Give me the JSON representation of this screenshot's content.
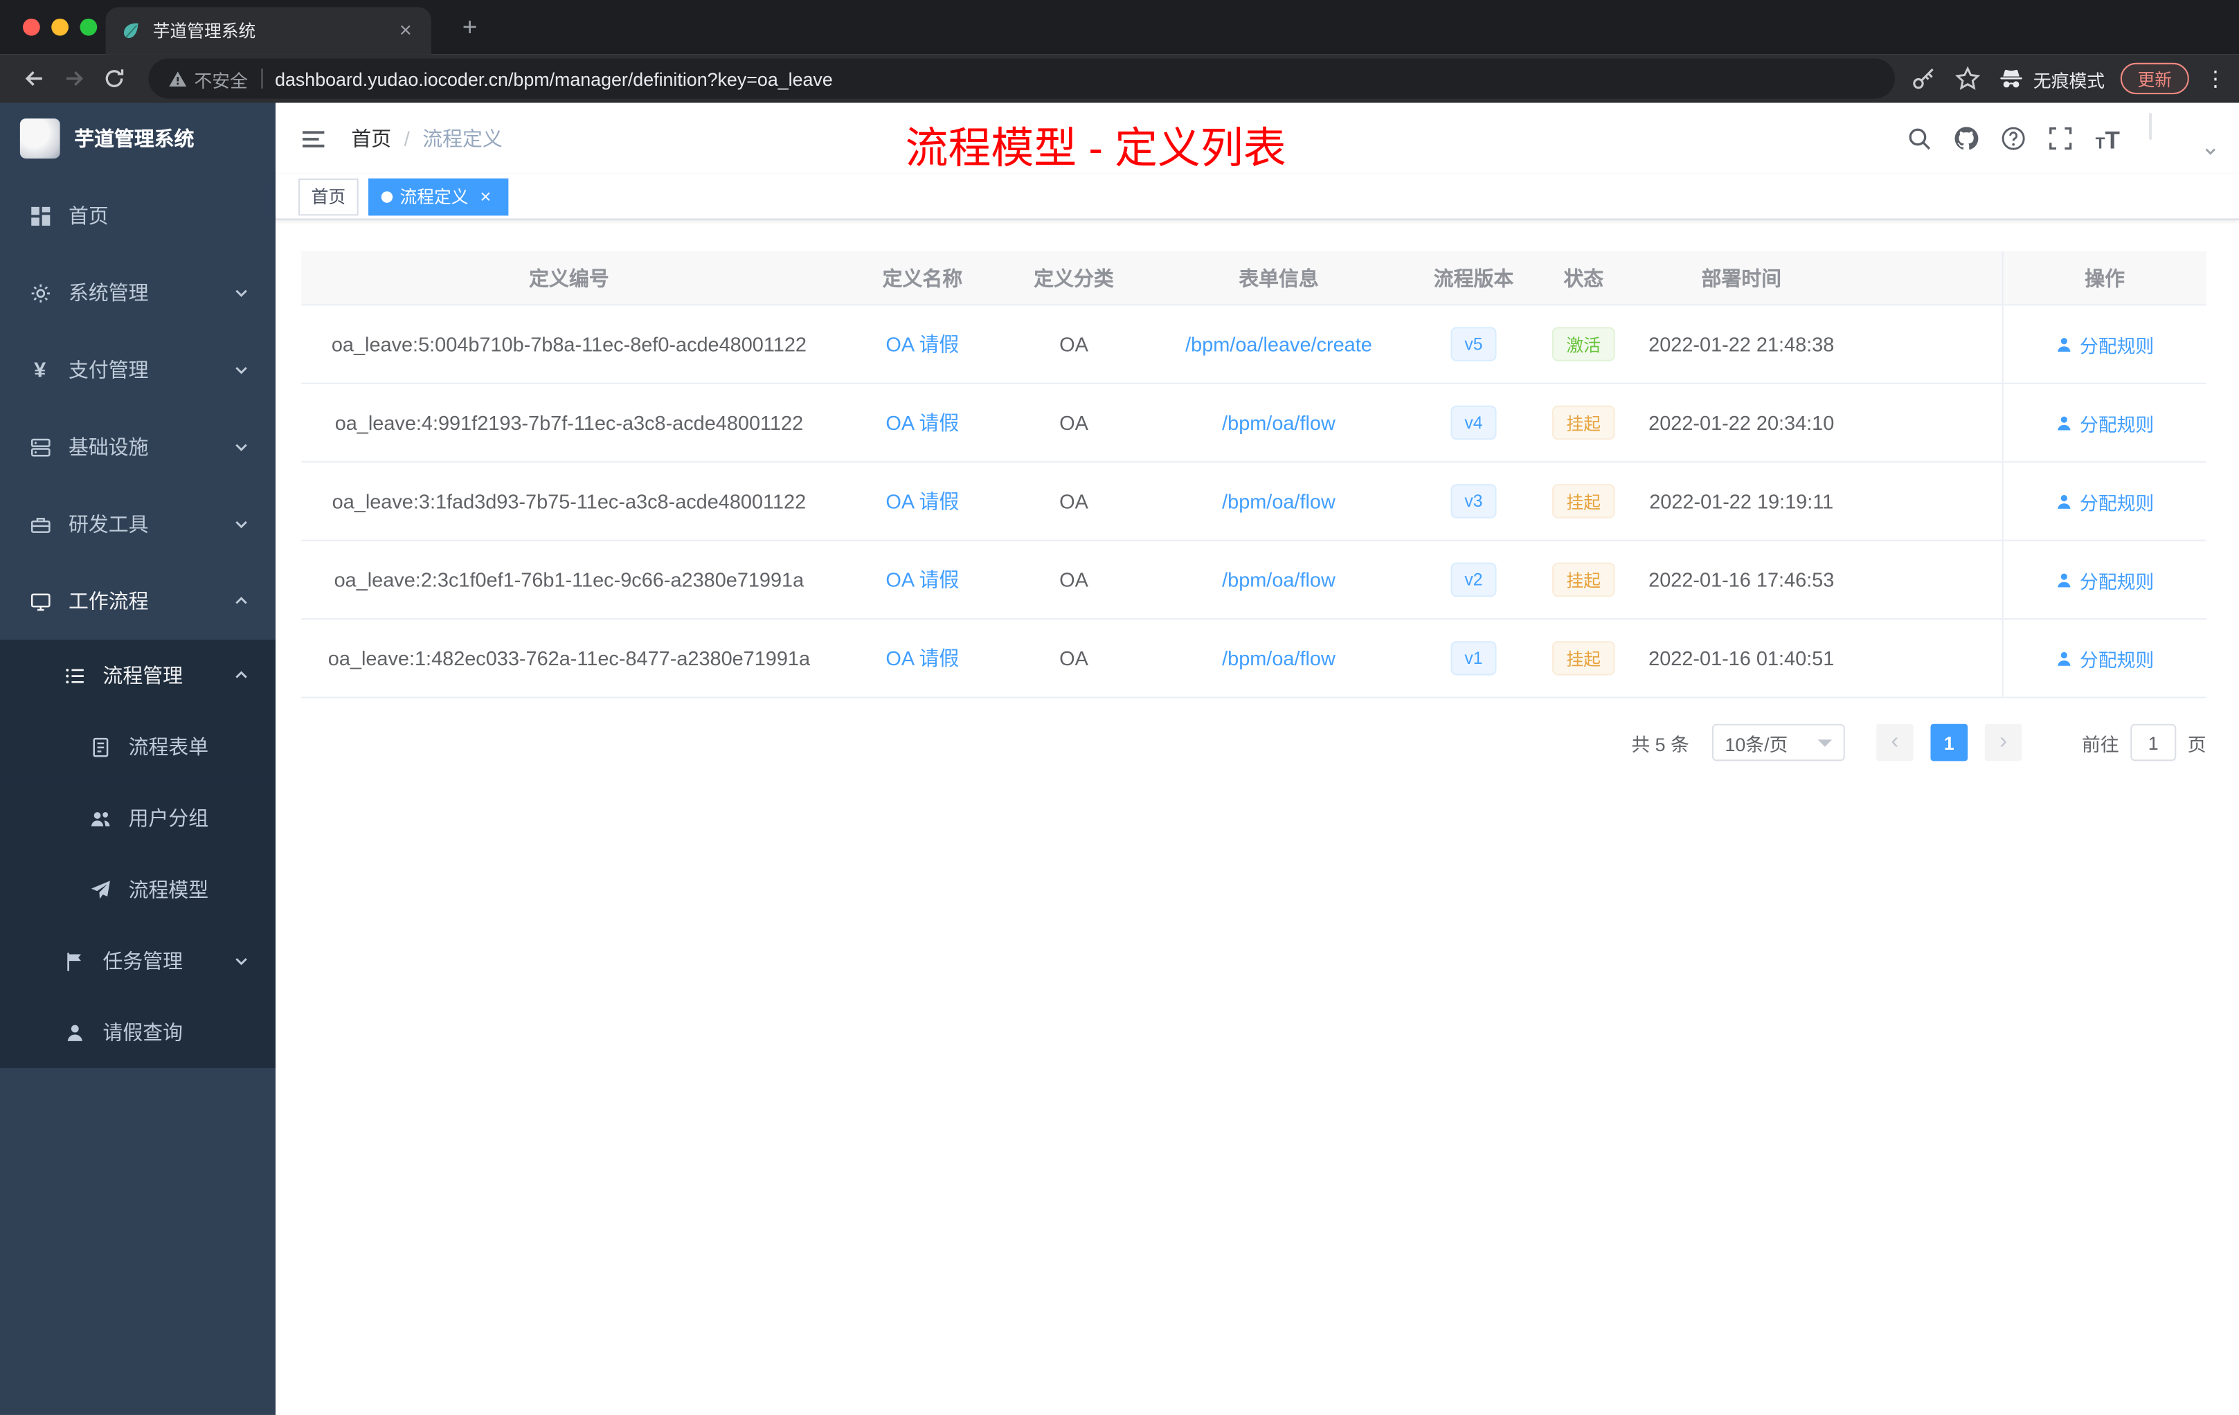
{
  "colors": {
    "accent": "#409eff",
    "success": "#67c23a",
    "warning": "#e6a23c",
    "annotation_red": "#ff0000",
    "sidebar_bg": "#304156",
    "submenu_bg": "#1f2d3d"
  },
  "browser": {
    "tab_title": "芋道管理系统",
    "security_label": "不安全",
    "url": "dashboard.yudao.iocoder.cn/bpm/manager/definition?key=oa_leave",
    "incognito_label": "无痕模式",
    "update_label": "更新"
  },
  "sidebar": {
    "logo_title": "芋道管理系统",
    "items": [
      {
        "label": "首页"
      },
      {
        "label": "系统管理"
      },
      {
        "label": "支付管理"
      },
      {
        "label": "基础设施"
      },
      {
        "label": "研发工具"
      },
      {
        "label": "工作流程"
      },
      {
        "label": "流程管理"
      },
      {
        "label": "流程表单"
      },
      {
        "label": "用户分组"
      },
      {
        "label": "流程模型"
      },
      {
        "label": "任务管理"
      },
      {
        "label": "请假查询"
      }
    ]
  },
  "navbar": {
    "breadcrumb_home": "首页",
    "breadcrumb_sep": "/",
    "breadcrumb_current": "流程定义",
    "annotation": "流程模型 - 定义列表"
  },
  "tags": {
    "home": "首页",
    "current": "流程定义"
  },
  "table": {
    "columns": [
      "定义编号",
      "定义名称",
      "定义分类",
      "表单信息",
      "流程版本",
      "状态",
      "部署时间",
      "操作"
    ],
    "rows": [
      {
        "id": "oa_leave:5:004b710b-7b8a-11ec-8ef0-acde48001122",
        "name": "OA 请假",
        "category": "OA",
        "form": "/bpm/oa/leave/create",
        "version": "v5",
        "status": "激活",
        "time": "2022-01-22 21:48:38",
        "action": "分配规则"
      },
      {
        "id": "oa_leave:4:991f2193-7b7f-11ec-a3c8-acde48001122",
        "name": "OA 请假",
        "category": "OA",
        "form": "/bpm/oa/flow",
        "version": "v4",
        "status": "挂起",
        "time": "2022-01-22 20:34:10",
        "action": "分配规则"
      },
      {
        "id": "oa_leave:3:1fad3d93-7b75-11ec-a3c8-acde48001122",
        "name": "OA 请假",
        "category": "OA",
        "form": "/bpm/oa/flow",
        "version": "v3",
        "status": "挂起",
        "time": "2022-01-22 19:19:11",
        "action": "分配规则"
      },
      {
        "id": "oa_leave:2:3c1f0ef1-76b1-11ec-9c66-a2380e71991a",
        "name": "OA 请假",
        "category": "OA",
        "form": "/bpm/oa/flow",
        "version": "v2",
        "status": "挂起",
        "time": "2022-01-16 17:46:53",
        "action": "分配规则"
      },
      {
        "id": "oa_leave:1:482ec033-762a-11ec-8477-a2380e71991a",
        "name": "OA 请假",
        "category": "OA",
        "form": "/bpm/oa/flow",
        "version": "v1",
        "status": "挂起",
        "time": "2022-01-16 01:40:51",
        "action": "分配规则"
      }
    ]
  },
  "pagination": {
    "total": "共 5 条",
    "page_size": "10条/页",
    "current_page": "1",
    "goto_prefix": "前往",
    "goto_value": "1",
    "goto_suffix": "页"
  }
}
